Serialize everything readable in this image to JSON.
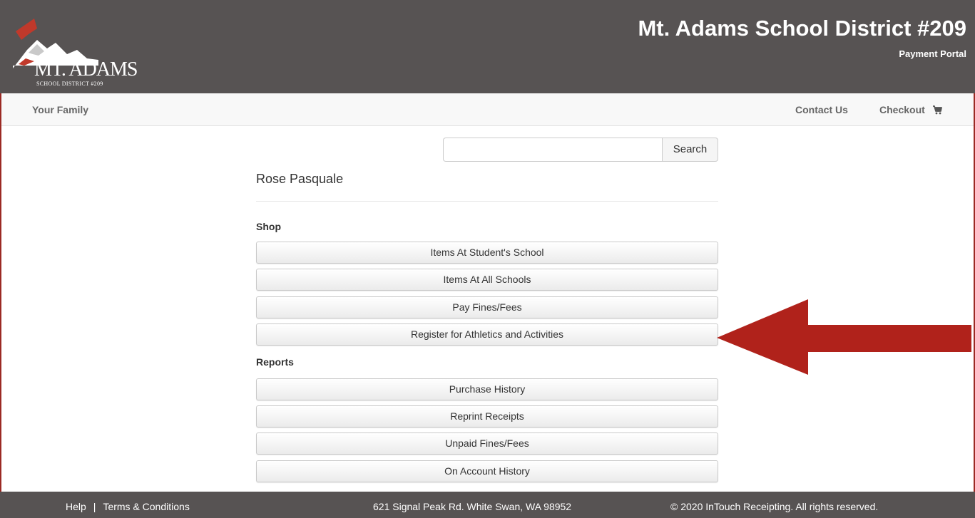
{
  "header": {
    "logo_main": "MT. ADAMS",
    "logo_sub": "SCHOOL DISTRICT #209",
    "title": "Mt. Adams School District #209",
    "subtitle": "Payment Portal"
  },
  "nav": {
    "family": "Your Family",
    "contact": "Contact Us",
    "checkout": "Checkout",
    "checkout_icon": "cart-icon"
  },
  "search": {
    "placeholder": "",
    "value": "",
    "button_label": "Search"
  },
  "user": {
    "name": "Rose Pasquale"
  },
  "shop": {
    "title": "Shop",
    "items": [
      {
        "label": "Items At Student's School"
      },
      {
        "label": "Items At All Schools"
      },
      {
        "label": "Pay Fines/Fees"
      },
      {
        "label": "Register for Athletics and Activities"
      }
    ]
  },
  "reports": {
    "title": "Reports",
    "items": [
      {
        "label": "Purchase History"
      },
      {
        "label": "Reprint Receipts"
      },
      {
        "label": "Unpaid Fines/Fees"
      },
      {
        "label": "On Account History"
      }
    ]
  },
  "annotation": {
    "arrow_color": "#b0221b"
  },
  "footer": {
    "help": "Help",
    "separator": "|",
    "terms": "Terms & Conditions",
    "address": "621 Signal Peak Rd. White Swan, WA 98952",
    "copyright": "© 2020 InTouch Receipting. All rights reserved."
  },
  "colors": {
    "header_bg": "#575353",
    "accent_red": "#9b2a24"
  }
}
